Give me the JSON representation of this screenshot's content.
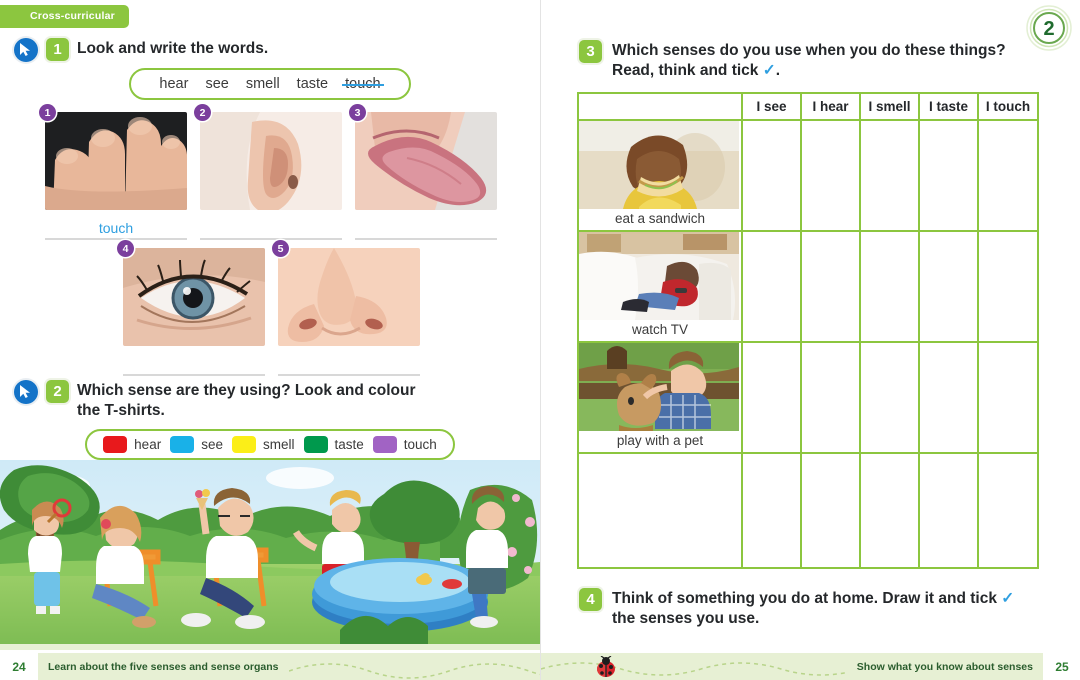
{
  "tab": {
    "label": "Cross-curricular"
  },
  "unit": {
    "number": "2"
  },
  "exercises": {
    "ex1": {
      "number": "1",
      "title": "Look and write the words.",
      "cursor_icon": "cursor-arrow-icon",
      "wordbank": [
        "hear",
        "see",
        "smell",
        "taste",
        "touch"
      ],
      "struck_word": "touch",
      "items": [
        {
          "num": "1",
          "photo": "hand-fingers-photo",
          "answer": "touch"
        },
        {
          "num": "2",
          "photo": "ear-photo",
          "answer": ""
        },
        {
          "num": "3",
          "photo": "tongue-mouth-photo",
          "answer": ""
        },
        {
          "num": "4",
          "photo": "eye-photo",
          "answer": ""
        },
        {
          "num": "5",
          "photo": "nose-photo",
          "answer": ""
        }
      ]
    },
    "ex2": {
      "number": "2",
      "title_line1": "Which sense are they using? Look and colour",
      "title_line2": "the T-shirts.",
      "cursor_icon": "cursor-arrow-icon",
      "legend": [
        {
          "label": "hear",
          "color": "#e8191c"
        },
        {
          "label": "see",
          "color": "#19b1e8"
        },
        {
          "label": "smell",
          "color": "#fbee18"
        },
        {
          "label": "taste",
          "color": "#00994d"
        },
        {
          "label": "touch",
          "color": "#a163c4"
        }
      ],
      "illustration": "park-family-scene-illustration"
    },
    "ex3": {
      "number": "3",
      "title_line1": "Which senses do you use when you do these things?",
      "title_line2": "Read, think and tick",
      "tick_glyph": "✓",
      "title_end": ".",
      "table": {
        "columns": [
          "",
          "I see",
          "I hear",
          "I smell",
          "I taste",
          "I touch"
        ],
        "rows": [
          {
            "label": "eat a sandwich",
            "photo": "boy-eating-sandwich-photo",
            "ticks": [
              "",
              "",
              "",
              "",
              ""
            ]
          },
          {
            "label": "watch TV",
            "photo": "girl-watching-tv-photo",
            "ticks": [
              "",
              "",
              "",
              "",
              ""
            ]
          },
          {
            "label": "play with a pet",
            "photo": "boy-with-dog-photo",
            "ticks": [
              "",
              "",
              "",
              "",
              ""
            ]
          },
          {
            "label": "",
            "photo": "",
            "ticks": [
              "",
              "",
              "",
              "",
              ""
            ]
          }
        ]
      }
    },
    "ex4": {
      "number": "4",
      "title_line1": "Think of something you do at home. Draw it and tick",
      "tick_glyph": "✓",
      "title_line2": "the senses you use."
    }
  },
  "footers": {
    "left": {
      "page": "24",
      "text": "Learn about the five senses and sense organs"
    },
    "right": {
      "page": "25",
      "text": "Show what you know about senses",
      "decor_icon": "ladybug-icon"
    }
  },
  "colors": {
    "green": "#8cc63f",
    "purple": "#7b3f9d",
    "blue": "#2f9fe0",
    "footer_bg": "#e7f0d4"
  }
}
